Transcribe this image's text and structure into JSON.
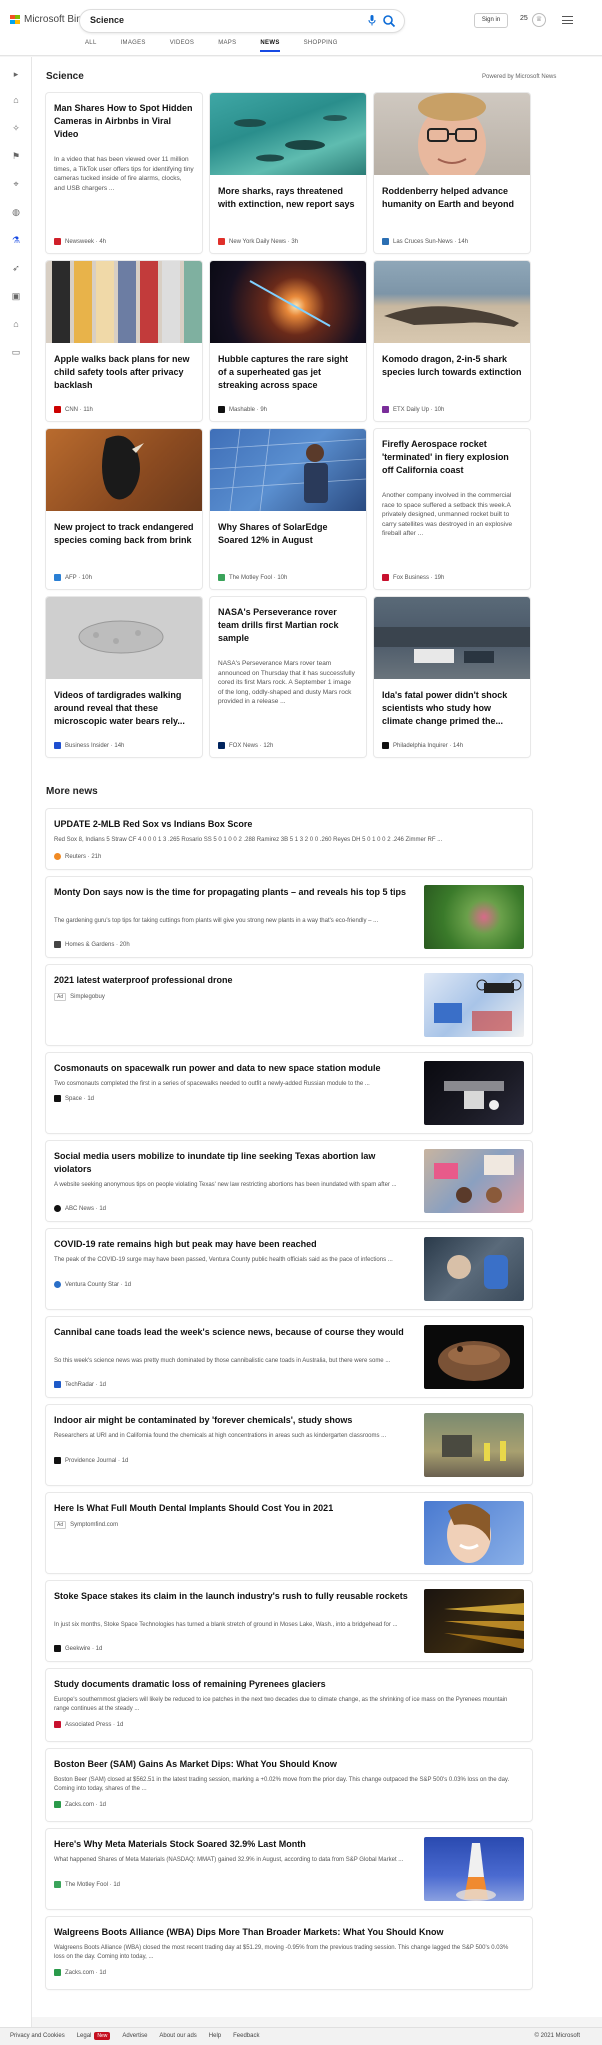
{
  "header": {
    "logo_text": "Microsoft Bing",
    "search_value": "Science",
    "signin": "Sign in",
    "rewards_count": "25",
    "tabs": [
      {
        "label": "ALL"
      },
      {
        "label": "IMAGES"
      },
      {
        "label": "VIDEOS"
      },
      {
        "label": "MAPS"
      },
      {
        "label": "NEWS"
      },
      {
        "label": "SHOPPING"
      }
    ]
  },
  "section": {
    "title": "Science",
    "powered": "Powered by Microsoft News"
  },
  "cards": [
    {
      "title": "Man Shares How to Spot Hidden Cameras in Airbnbs in Viral Video",
      "desc": "In a video that has been viewed over 11 million times, a TikTok user offers tips for identifying tiny cameras tucked inside of fire alarms, clocks, and USB chargers ...",
      "source": "Newsweek · 4h"
    },
    {
      "title": "More sharks, rays threatened with extinction, new report says",
      "source": "New York Daily News · 3h"
    },
    {
      "title": "Roddenberry helped advance humanity on Earth and beyond",
      "source": "Las Cruces Sun-News · 14h"
    },
    {
      "title": "Apple walks back plans for new child safety tools after privacy backlash",
      "source": "CNN · 11h"
    },
    {
      "title": "Hubble captures the rare sight of a superheated gas jet streaking across space",
      "source": "Mashable · 9h"
    },
    {
      "title": "Komodo dragon, 2-in-5 shark species lurch towards extinction",
      "source": "ETX Daily Up · 10h"
    },
    {
      "title": "New project to track endangered species coming back from brink",
      "source": "AFP · 10h"
    },
    {
      "title": "Why Shares of SolarEdge Soared 12% in August",
      "source": "The Motley Fool · 10h"
    },
    {
      "title": "Firefly Aerospace rocket 'terminated' in fiery explosion off California coast",
      "desc": "Another company involved in the commercial race to space suffered a setback this week.A privately designed, unmanned rocket built to carry satellites was destroyed in an explosive fireball after ...",
      "source": "Fox Business · 19h"
    },
    {
      "title": "Videos of tardigrades walking around reveal that these microscopic water bears rely...",
      "source": "Business Insider · 14h"
    },
    {
      "title": "NASA's Perseverance rover team drills first Martian rock sample",
      "desc": "NASA's Perseverance Mars rover team announced on Thursday that it has successfully cored its first Mars rock.  A September 1 image of the long, oddly-shaped and dusty Mars rock provided in a release ...",
      "source": "FOX News · 12h"
    },
    {
      "title": "Ida's fatal power didn't shock scientists who study how climate change primed the...",
      "source": "Philadelphia Inquirer · 14h"
    }
  ],
  "more_news": {
    "title": "More news",
    "items": [
      {
        "title": "UPDATE 2-MLB Red Sox vs Indians Box Score",
        "desc": "Red Sox 8, Indians 5 Straw CF 4 0 0 0 1 3 .265 Rosario SS 5 0 1 0 0 2 .288 Ramirez 3B 5 1 3 2 0 0 .260 Reyes DH 5 0 1 0 0 2 .246 Zimmer RF ...",
        "source": "Reuters · 21h"
      },
      {
        "title": "Monty Don says now is the time for propagating plants – and reveals his top 5 tips",
        "desc": "The gardening guru's top tips for taking cuttings from plants will give you strong new plants in a way that's eco-friendly – ...",
        "source": "Homes & Gardens · 20h"
      },
      {
        "title": "2021 latest waterproof professional drone",
        "ad": "Ad",
        "source": "Simplegobuy"
      },
      {
        "title": "Cosmonauts on spacewalk run power and data to new space station module",
        "desc": "Two cosmonauts completed the first in a series of spacewalks needed to outfit a newly-added Russian module to the ...",
        "source": "Space · 1d"
      },
      {
        "title": "Social media users mobilize to inundate tip line seeking Texas abortion law violators",
        "desc": "A website seeking anonymous tips on people violating Texas' new law restricting abortions has been inundated with spam after ...",
        "source": "ABC News · 1d"
      },
      {
        "title": "COVID-19 rate remains high but peak may have been reached",
        "desc": "The peak of the COVID-19 surge may have been passed, Ventura County public health officials said as the pace of infections ...",
        "source": "Ventura County Star · 1d"
      },
      {
        "title": "Cannibal cane toads lead the week's science news, because of course they would",
        "desc": "So this week's science news was pretty much dominated by those cannibalistic cane toads in Australia, but there were some ...",
        "source": "TechRadar · 1d"
      },
      {
        "title": "Indoor air might be contaminated by 'forever chemicals', study shows",
        "desc": "Researchers at URI and in California found the chemicals at high concentrations in areas such as kindergarten classrooms ...",
        "source": "Providence Journal · 1d"
      },
      {
        "title": "Here Is What Full Mouth Dental Implants Should Cost You in 2021",
        "ad": "Ad",
        "source": "Symptomfind.com"
      },
      {
        "title": "Stoke Space stakes its claim in the launch industry's rush to fully reusable rockets",
        "desc": "In just six months, Stoke Space Technologies has turned a blank stretch of ground in Moses Lake, Wash., into a bridgehead for ...",
        "source": "Geekwire · 1d"
      },
      {
        "title": "Study documents dramatic loss of remaining Pyrenees glaciers",
        "desc": "Europe's southernmost glaciers will likely be reduced to ice patches in the next two decades due to climate change, as the shrinking of ice mass on the Pyrenees mountain range continues at the steady ...",
        "source": "Associated Press · 1d"
      },
      {
        "title": "Boston Beer (SAM) Gains As Market Dips: What You Should Know",
        "desc": "Boston Beer (SAM) closed at $562.51 in the latest trading session, marking a +0.02% move from the prior day. This change outpaced the S&P 500's 0.03% loss on the day. Coming into today, shares of the ...",
        "source": "Zacks.com · 1d"
      },
      {
        "title": "Here's Why Meta Materials Stock Soared 32.9% Last Month",
        "desc": "What happened Shares of Meta Materials (NASDAQ: MMAT) gained 32.9% in August, according to data from S&P Global Market ...",
        "source": "The Motley Fool · 1d"
      },
      {
        "title": "Walgreens Boots Alliance (WBA) Dips More Than Broader Markets: What You Should Know",
        "desc": "Walgreens Boots Alliance (WBA) closed the most recent trading day at $51.29, moving -0.95% from the previous trading session. This change lagged the S&P 500's 0.03% loss on the day. Coming into today, ...",
        "source": "Zacks.com · 1d"
      }
    ]
  },
  "footer": {
    "links": [
      "Privacy and Cookies",
      "Legal",
      "Advertise",
      "About our ads",
      "Help",
      "Feedback"
    ],
    "new_badge": "New",
    "copyright": "© 2021 Microsoft"
  },
  "colors": {
    "accent": "#174ae4",
    "bing_blue": "#0c6bd6"
  }
}
